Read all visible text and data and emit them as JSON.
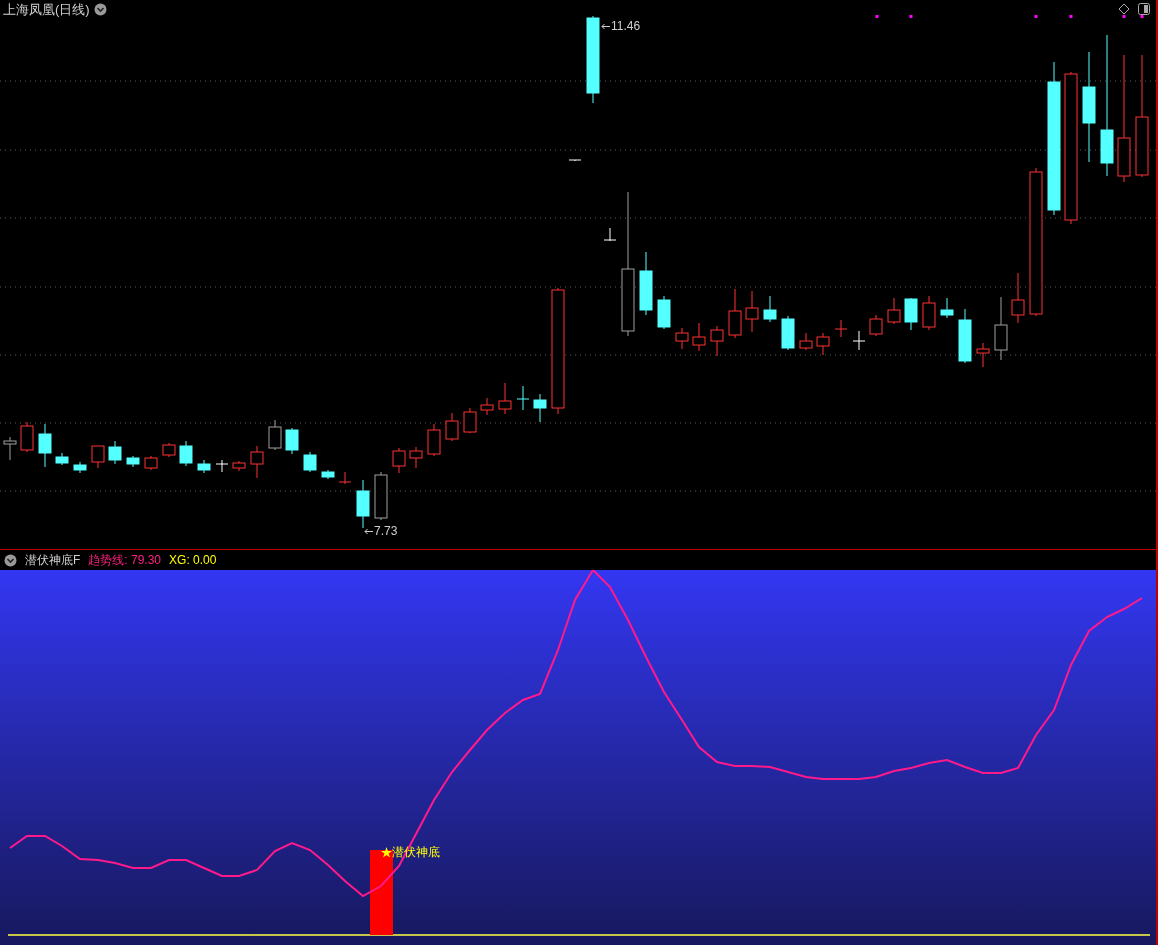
{
  "price_chart": {
    "title": "上海凤凰(日线)",
    "high_label": "11.46",
    "low_label": "7.73"
  },
  "indicator": {
    "name": "潜伏神底F",
    "readings": [
      {
        "text": "趋势线: 79.30",
        "kind": "trend"
      },
      {
        "text": "XG: 0.00",
        "kind": "signal"
      }
    ],
    "signal_label": "潜伏神底"
  }
}
